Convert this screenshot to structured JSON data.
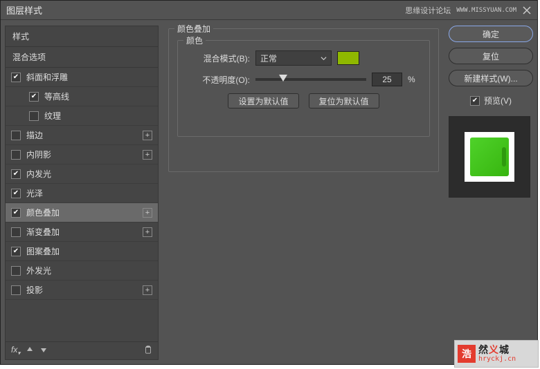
{
  "window": {
    "title": "图层样式",
    "forum_text": "思缘设计论坛",
    "forum_url": "WWW.MISSYUAN.COM"
  },
  "sidebar": {
    "header": "样式",
    "subheader": "混合选项",
    "items": [
      {
        "label": "斜面和浮雕",
        "checked": true,
        "hasPlus": false,
        "indent": false
      },
      {
        "label": "等高线",
        "checked": true,
        "hasPlus": false,
        "indent": true
      },
      {
        "label": "纹理",
        "checked": false,
        "hasPlus": false,
        "indent": true
      },
      {
        "label": "描边",
        "checked": false,
        "hasPlus": true,
        "indent": false
      },
      {
        "label": "内阴影",
        "checked": false,
        "hasPlus": true,
        "indent": false
      },
      {
        "label": "内发光",
        "checked": true,
        "hasPlus": false,
        "indent": false
      },
      {
        "label": "光泽",
        "checked": true,
        "hasPlus": false,
        "indent": false
      },
      {
        "label": "颜色叠加",
        "checked": true,
        "hasPlus": true,
        "indent": false,
        "selected": true
      },
      {
        "label": "渐变叠加",
        "checked": false,
        "hasPlus": true,
        "indent": false
      },
      {
        "label": "图案叠加",
        "checked": true,
        "hasPlus": false,
        "indent": false
      },
      {
        "label": "外发光",
        "checked": false,
        "hasPlus": false,
        "indent": false
      },
      {
        "label": "投影",
        "checked": false,
        "hasPlus": true,
        "indent": false
      }
    ],
    "footer_fx": "fx"
  },
  "main": {
    "fieldset_title": "颜色叠加",
    "inner_title": "颜色",
    "blend_label": "混合模式(B):",
    "blend_value": "正常",
    "overlay_color": "#8fb800",
    "opacity_label": "不透明度(O):",
    "opacity_value": "25",
    "opacity_unit": "%",
    "btn_default": "设置为默认值",
    "btn_reset": "复位为默认值"
  },
  "right": {
    "ok": "确定",
    "cancel": "复位",
    "new_style": "新建样式(W)...",
    "preview_label": "预览(V)",
    "preview_checked": true
  },
  "watermark": {
    "badge": "浩",
    "title_a": "然",
    "title_b": "义",
    "title_c": "城",
    "url": "hryckj.cn"
  }
}
